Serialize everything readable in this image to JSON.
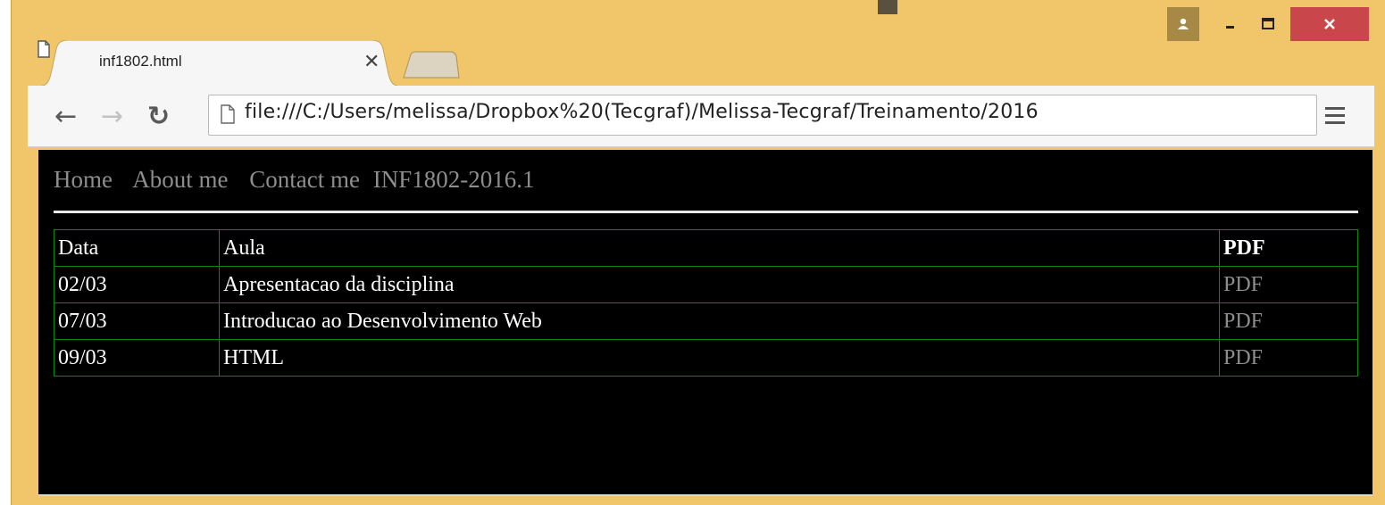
{
  "browser": {
    "tab_title": "inf1802.html",
    "url": "file:///C:/Users/melissa/Dropbox%20(Tecgraf)/Melissa-Tecgraf/Treinamento/2016",
    "colors": {
      "frame": "#f1c66b",
      "close": "#c9474b",
      "user": "#a78845"
    }
  },
  "page": {
    "nav": [
      "Home",
      "About me",
      "Contact me"
    ],
    "course": "INF1802-2016.1",
    "table": {
      "headers": [
        "Data",
        "Aula",
        "PDF"
      ],
      "rows": [
        [
          "02/03",
          "Apresentacao da disciplina",
          "PDF"
        ],
        [
          "07/03",
          "Introducao ao Desenvolvimento Web",
          "PDF"
        ],
        [
          "09/03",
          "HTML",
          "PDF"
        ]
      ]
    }
  }
}
